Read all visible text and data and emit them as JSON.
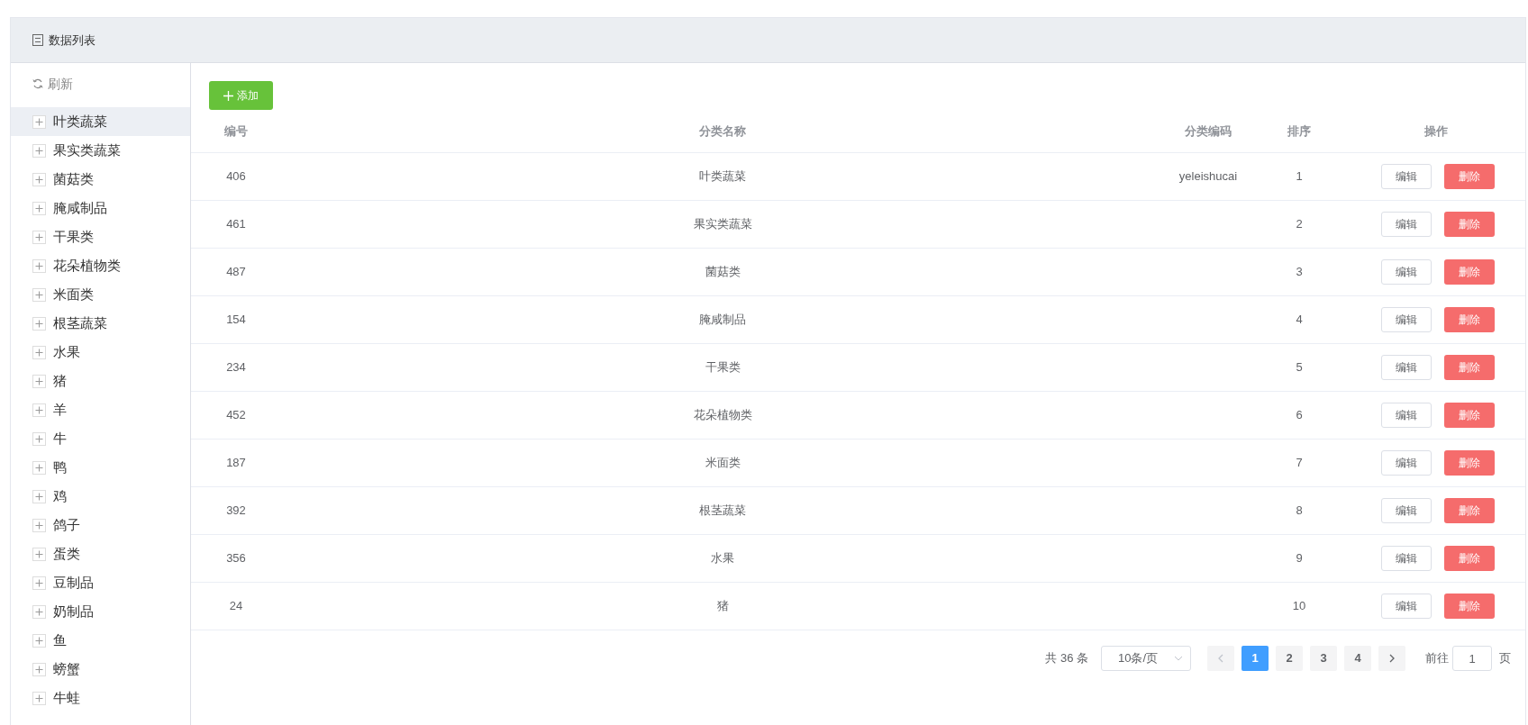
{
  "panel": {
    "title": "数据列表"
  },
  "sidebar": {
    "refresh": "刷新",
    "items": [
      {
        "label": "叶类蔬菜",
        "selected": true
      },
      {
        "label": "果实类蔬菜",
        "selected": false
      },
      {
        "label": "菌菇类",
        "selected": false
      },
      {
        "label": "腌咸制品",
        "selected": false
      },
      {
        "label": "干果类",
        "selected": false
      },
      {
        "label": "花朵植物类",
        "selected": false
      },
      {
        "label": "米面类",
        "selected": false
      },
      {
        "label": "根茎蔬菜",
        "selected": false
      },
      {
        "label": "水果",
        "selected": false
      },
      {
        "label": "猪",
        "selected": false
      },
      {
        "label": "羊",
        "selected": false
      },
      {
        "label": "牛",
        "selected": false
      },
      {
        "label": "鸭",
        "selected": false
      },
      {
        "label": "鸡",
        "selected": false
      },
      {
        "label": "鸽子",
        "selected": false
      },
      {
        "label": "蛋类",
        "selected": false
      },
      {
        "label": "豆制品",
        "selected": false
      },
      {
        "label": "奶制品",
        "selected": false
      },
      {
        "label": "鱼",
        "selected": false
      },
      {
        "label": "螃蟹",
        "selected": false
      },
      {
        "label": "牛蛙",
        "selected": false
      }
    ]
  },
  "add_button": "添加",
  "table": {
    "columns": [
      "编号",
      "分类名称",
      "分类编码",
      "排序",
      "操作"
    ],
    "rows": [
      {
        "id": "406",
        "name": "叶类蔬菜",
        "code": "yeleishucai",
        "sort": "1",
        "edit": "编辑",
        "delete": "删除"
      },
      {
        "id": "461",
        "name": "果实类蔬菜",
        "sort": "2",
        "edit": "编辑",
        "delete": "删除"
      },
      {
        "id": "487",
        "name": "菌菇类",
        "sort": "3",
        "edit": "编辑",
        "delete": "删除"
      },
      {
        "id": "154",
        "name": "腌咸制品",
        "sort": "4",
        "edit": "编辑",
        "delete": "删除"
      },
      {
        "id": "234",
        "name": "干果类",
        "sort": "5",
        "edit": "编辑",
        "delete": "删除"
      },
      {
        "id": "452",
        "name": "花朵植物类",
        "sort": "6",
        "edit": "编辑",
        "delete": "删除"
      },
      {
        "id": "187",
        "name": "米面类",
        "sort": "7",
        "edit": "编辑",
        "delete": "删除"
      },
      {
        "id": "392",
        "name": "根茎蔬菜",
        "sort": "8",
        "edit": "编辑",
        "delete": "删除"
      },
      {
        "id": "356",
        "name": "水果",
        "sort": "9",
        "edit": "编辑",
        "delete": "删除"
      },
      {
        "id": "24",
        "name": "猪",
        "sort": "10",
        "edit": "编辑",
        "delete": "删除"
      }
    ]
  },
  "pagination": {
    "total": "共 36 条",
    "page_size": "10条/页",
    "pages": [
      {
        "label": "1",
        "selected": true
      },
      {
        "label": "2",
        "selected": false
      },
      {
        "label": "3",
        "selected": false
      },
      {
        "label": "4",
        "selected": false
      }
    ],
    "goto_label": "前往",
    "goto_value": "1",
    "goto_suffix": "页"
  }
}
